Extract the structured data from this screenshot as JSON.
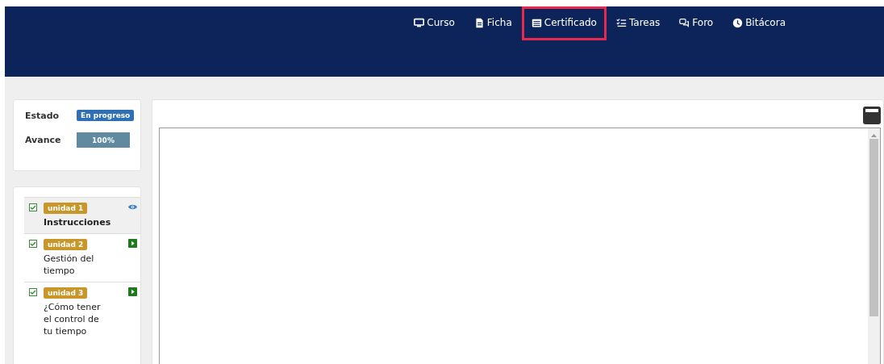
{
  "nav": [
    {
      "kind": "monitor",
      "label": "Curso",
      "selected": false
    },
    {
      "kind": "file",
      "label": "Ficha",
      "selected": false
    },
    {
      "kind": "list",
      "label": "Certificado",
      "selected": true
    },
    {
      "kind": "tasks",
      "label": "Tareas",
      "selected": false
    },
    {
      "kind": "chat",
      "label": "Foro",
      "selected": false
    },
    {
      "kind": "clock",
      "label": "Bitácora",
      "selected": false
    }
  ],
  "status": {
    "estado_label": "Estado",
    "estado": "En progreso",
    "avance_label": "Avance",
    "avance": "100%",
    "level": 1
  },
  "units": [
    {
      "badge": "unidad 1",
      "title": "Instrucciones",
      "checked": true,
      "selected": true,
      "kind": "view"
    },
    {
      "badge": "unidad 2",
      "title": "Gestión del tiempo",
      "checked": true,
      "selected": false,
      "kind": "play"
    },
    {
      "badge": "unidad 3",
      "title": "¿Cómo tener el control de tu tiempo",
      "checked": true,
      "selected": false,
      "kind": "play"
    }
  ]
}
